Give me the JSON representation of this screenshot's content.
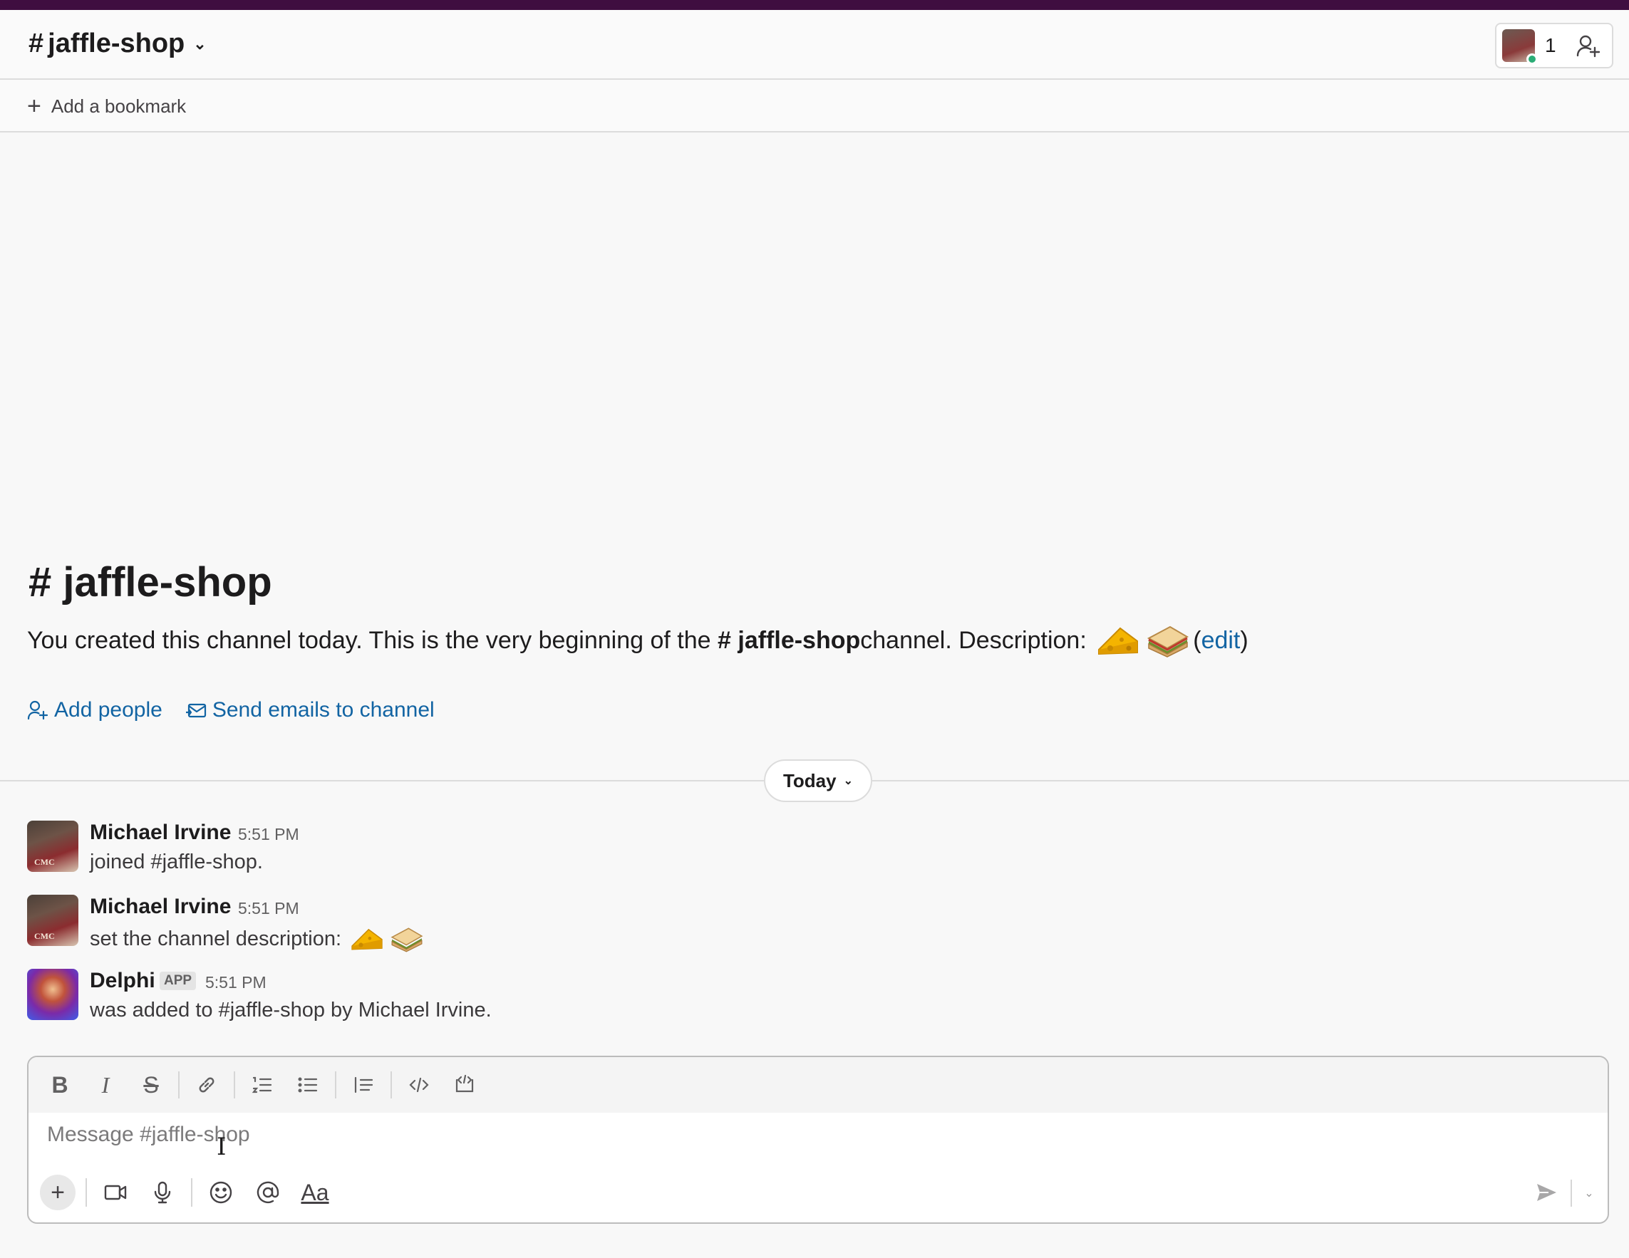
{
  "header": {
    "hash": "#",
    "channel_name": "jaffle-shop",
    "member_count": "1"
  },
  "bookmarks": {
    "add_label": "Add a bookmark"
  },
  "intro": {
    "hash": "#",
    "title": "jaffle-shop",
    "desc_prefix": "You created this channel today. This is the very beginning of the ",
    "desc_channel": "# jaffle-shop",
    "desc_suffix": " channel. Description:",
    "edit_open": "(",
    "edit_label": "edit",
    "edit_close": ")",
    "actions": {
      "add_people": "Add people",
      "send_emails": "Send emails to channel"
    }
  },
  "divider": {
    "label": "Today"
  },
  "messages": [
    {
      "author": "Michael Irvine",
      "time": "5:51 PM",
      "text": "joined #jaffle-shop."
    },
    {
      "author": "Michael Irvine",
      "time": "5:51 PM",
      "text": "set the channel description:"
    },
    {
      "author": "Delphi",
      "tag": "APP",
      "time": "5:51 PM",
      "text": "was added to #jaffle-shop by Michael Irvine."
    }
  ],
  "composer": {
    "placeholder": "Message #jaffle-shop",
    "format_label": "Aa"
  },
  "colors": {
    "brand_strip": "#3f0e40",
    "link": "#1264a3",
    "presence": "#2bac76"
  }
}
